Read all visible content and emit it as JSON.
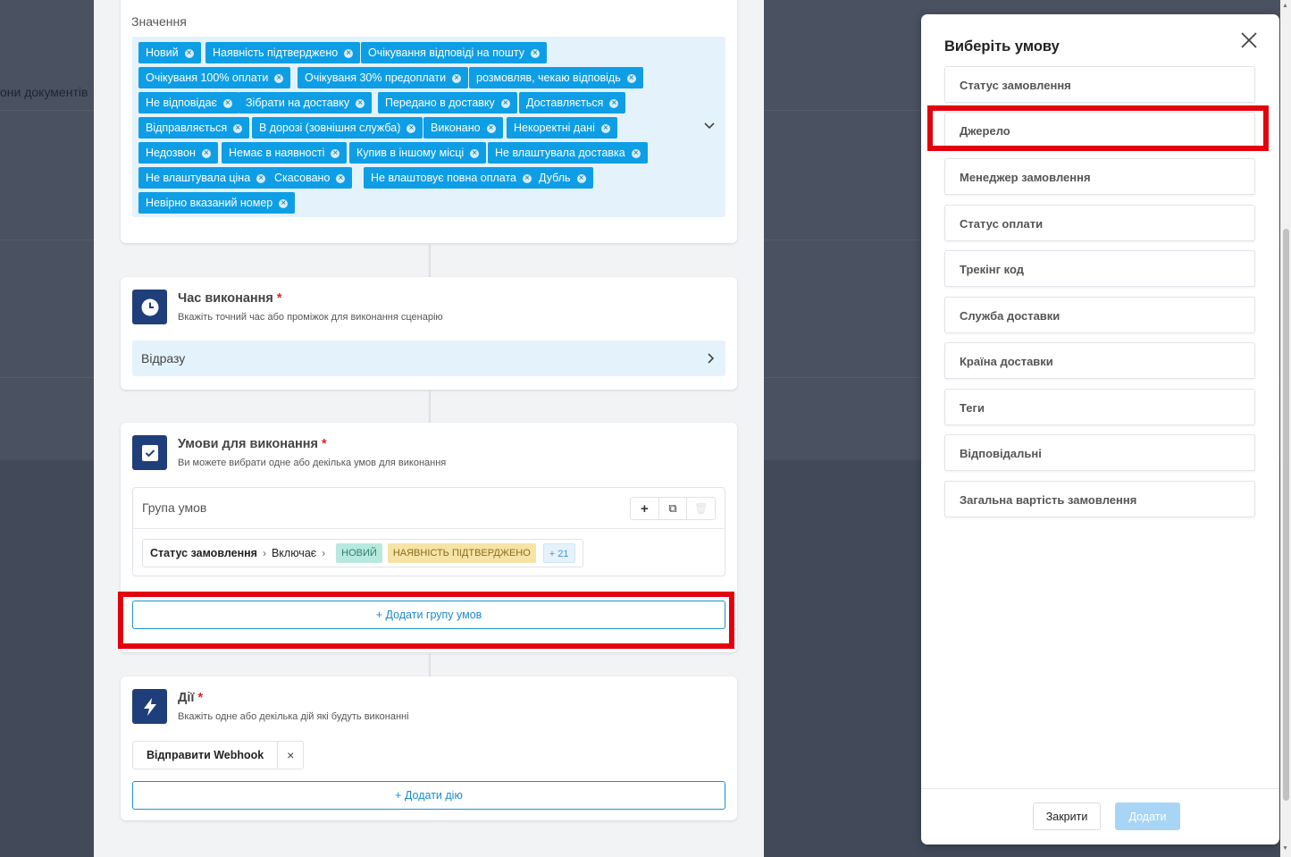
{
  "background": {
    "partial_text": "они документів"
  },
  "values_card": {
    "label": "Значення",
    "tags": [
      "Новий",
      "Наявність підтверджено",
      "Очікування відповіді на пошту",
      "Очікуваня 100% оплати",
      "Очікуваня 30% предоплати",
      "розмовляв, чекаю відповідь",
      "Не відповідає",
      "Зібрати на доставку",
      "Передано в доставку",
      "Доставляється",
      "Відправляється",
      "В дорозі (зовнішня служба)",
      "Виконано",
      "Некоректні дані",
      "Недозвон",
      "Немає в наявності",
      "Купив в іншому місці",
      "Не влаштувала доставка",
      "Не влаштувала ціна",
      "Скасовано",
      "Не влаштовує повна оплата",
      "Дубль",
      "Невірно вказаний номер"
    ],
    "tag_remove": "×"
  },
  "time_card": {
    "icon": "clock-icon",
    "title": "Час виконання",
    "required_mark": "*",
    "subtitle": "Вкажіть точний час або проміжок для виконання сценарію",
    "value": "Відразу"
  },
  "conditions_card": {
    "icon": "checkbox-icon",
    "title": "Умови для виконання",
    "required_mark": "*",
    "subtitle": "Ви можете вибрати одне або декілька умов для виконання",
    "group": {
      "title": "Група умов",
      "tools": {
        "add": "+",
        "copy": "⧉",
        "delete": "🗑"
      },
      "condition": {
        "field": "Статус замовлення",
        "operator": "Включає",
        "values": [
          "НОВИЙ",
          "НАЯВНІСТЬ ПІДТВЕРДЖЕНО"
        ],
        "more": "+ 21"
      }
    },
    "add_group_label": "+ Додати групу умов"
  },
  "actions_card": {
    "icon": "lightning-icon",
    "title": "Дії",
    "required_mark": "*",
    "subtitle": "Вкажіть одне або декілька дій які будуть виконанні",
    "action": {
      "label": "Відправити Webhook",
      "remove": "×"
    },
    "add_action_label": "+ Додати дію"
  },
  "dialog": {
    "title": "Виберіть умову",
    "options": [
      "Статус замовлення",
      "Джерело",
      "Менеджер замовлення",
      "Статус оплати",
      "Трекінг код",
      "Служба доставки",
      "Країна доставки",
      "Теги",
      "Відповідальні",
      "Загальна вартість замовлення"
    ],
    "close_label": "Закрити",
    "add_label": "Додати"
  },
  "colors": {
    "accent": "#0e9ee6",
    "icon_bg": "#1f3f7a",
    "highlight_red": "#e3000f",
    "required": "#e02424"
  }
}
